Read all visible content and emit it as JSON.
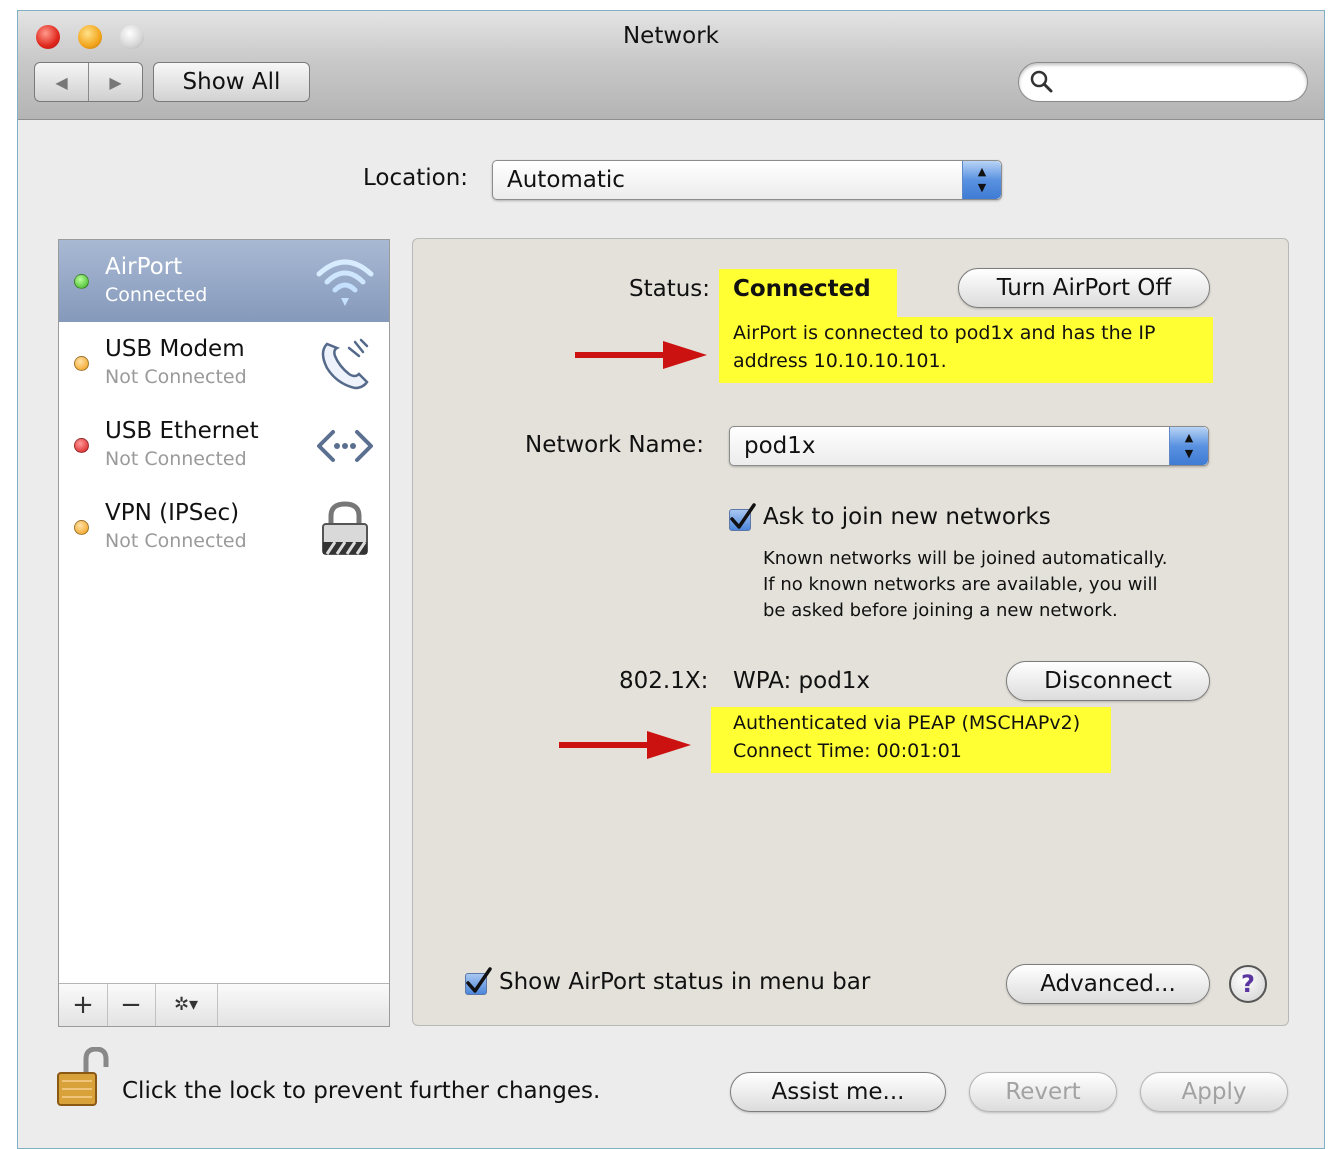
{
  "window": {
    "title": "Network"
  },
  "toolbar": {
    "back": "◀",
    "forward": "▶",
    "show_all": "Show All",
    "search_placeholder": "",
    "search_value": ""
  },
  "location": {
    "label": "Location:",
    "value": "Automatic"
  },
  "services": [
    {
      "name": "AirPort",
      "status": "Connected",
      "dot": "green",
      "icon": "wifi-icon",
      "selected": true
    },
    {
      "name": "USB Modem",
      "status": "Not Connected",
      "dot": "orange",
      "icon": "phone-icon",
      "selected": false
    },
    {
      "name": "USB Ethernet",
      "status": "Not Connected",
      "dot": "red",
      "icon": "ethernet-icon",
      "selected": false
    },
    {
      "name": "VPN (IPSec)",
      "status": "Not Connected",
      "dot": "orange",
      "icon": "lock-icon",
      "selected": false
    }
  ],
  "sidebar_toolbar": {
    "add": "+",
    "remove": "−",
    "action": "✲▾"
  },
  "detail": {
    "status_label": "Status:",
    "status_value": "Connected",
    "turn_off_button": "Turn AirPort Off",
    "status_desc_1": "AirPort is connected to pod1x and has the IP",
    "status_desc_2": "address 10.10.10.101.",
    "network_name_label": "Network Name:",
    "network_name_value": "pod1x",
    "ask_join_label": "Ask to join new networks",
    "ask_join_checked": true,
    "ask_join_help_1": "Known networks will be joined automatically.",
    "ask_join_help_2": "If no known networks are available, you will",
    "ask_join_help_3": "be asked before joining a new network.",
    "dot1x_label": "802.1X:",
    "dot1x_value": "WPA: pod1x",
    "disconnect_button": "Disconnect",
    "auth_line_1": "Authenticated via PEAP (MSCHAPv2)",
    "auth_line_2": "Connect Time: 00:01:01",
    "show_status_label": "Show AirPort status in menu bar",
    "show_status_checked": true,
    "advanced_button": "Advanced...",
    "help_button": "?"
  },
  "footer": {
    "lock_text": "Click the lock to prevent further changes.",
    "assist_button": "Assist me...",
    "revert_button": "Revert",
    "apply_button": "Apply"
  },
  "colors": {
    "highlight": "#ffff33",
    "arrow": "#cc1111",
    "selection": "#8fa2c2"
  }
}
